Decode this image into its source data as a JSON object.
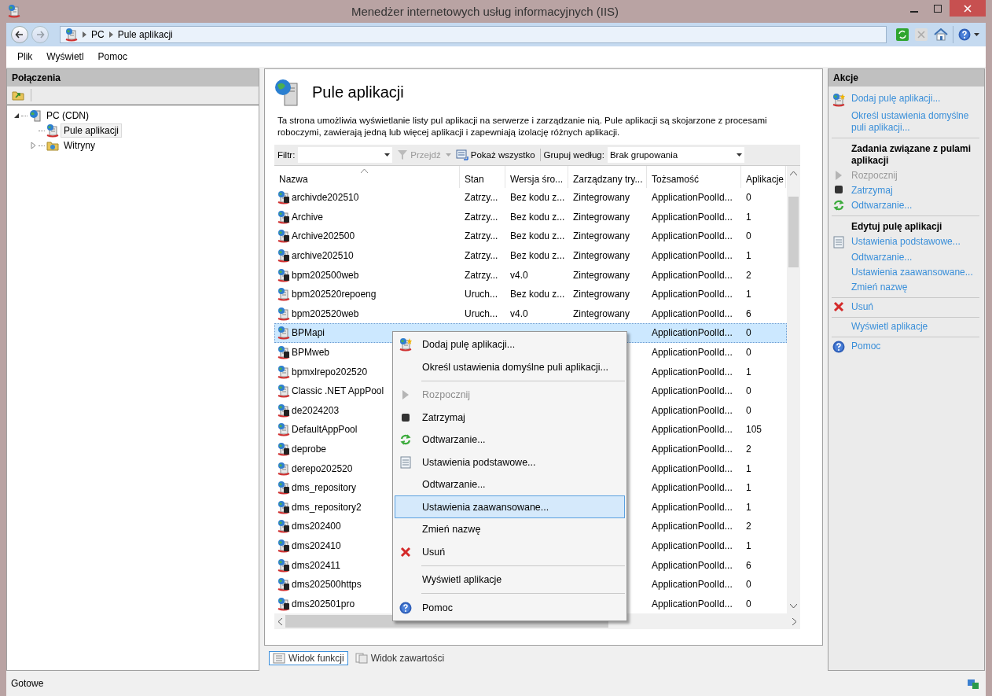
{
  "window": {
    "title": "Menedżer internetowych usług informacyjnych (IIS)"
  },
  "address": {
    "crumbs": [
      "PC",
      "Pule aplikacji"
    ]
  },
  "menu": [
    "Plik",
    "Wyświetl",
    "Pomoc"
  ],
  "connections": {
    "title": "Połączenia",
    "tree": [
      {
        "label": "PC (CDN)",
        "kind": "server",
        "expanded": true,
        "selected": false,
        "children": [
          {
            "label": "Pule aplikacji",
            "kind": "pool",
            "selected": true
          },
          {
            "label": "Witryny",
            "kind": "folder",
            "expanded": false,
            "selected": false
          }
        ]
      }
    ]
  },
  "page": {
    "title": "Pule aplikacji",
    "description": "Ta strona umożliwia wyświetlanie listy pul aplikacji na serwerze i zarządzanie nią. Pule aplikacji są skojarzone z procesami roboczymi, zawierają jedną lub więcej aplikacji i zapewniają izolację różnych aplikacji."
  },
  "filter_bar": {
    "filter_label": "Filtr:",
    "go": {
      "label": "Przejdź",
      "disabled": true
    },
    "show_all": "Pokaż wszystko",
    "group_label": "Grupuj według:",
    "group_value": "Brak grupowania"
  },
  "table": {
    "columns": [
      "Nazwa",
      "Stan",
      "Wersja śro...",
      "Zarządzany try...",
      "Tożsamość",
      "Aplikacje"
    ],
    "rows": [
      {
        "name": "archivde202510",
        "stopped": true,
        "selected": false,
        "state": "Zatrzy...",
        "version": "Bez kodu z...",
        "mode": "Zintegrowany",
        "identity": "ApplicationPoolId...",
        "apps": "0"
      },
      {
        "name": "Archive",
        "stopped": true,
        "selected": false,
        "state": "Zatrzy...",
        "version": "Bez kodu z...",
        "mode": "Zintegrowany",
        "identity": "ApplicationPoolId...",
        "apps": "1"
      },
      {
        "name": "Archive202500",
        "stopped": true,
        "selected": false,
        "state": "Zatrzy...",
        "version": "Bez kodu z...",
        "mode": "Zintegrowany",
        "identity": "ApplicationPoolId...",
        "apps": "0"
      },
      {
        "name": "archive202510",
        "stopped": true,
        "selected": false,
        "state": "Zatrzy...",
        "version": "Bez kodu z...",
        "mode": "Zintegrowany",
        "identity": "ApplicationPoolId...",
        "apps": "1"
      },
      {
        "name": "bpm202500web",
        "stopped": true,
        "selected": false,
        "state": "Zatrzy...",
        "version": "v4.0",
        "mode": "Zintegrowany",
        "identity": "ApplicationPoolId...",
        "apps": "2"
      },
      {
        "name": "bpm202520repoeng",
        "stopped": false,
        "selected": false,
        "state": "Uruch...",
        "version": "Bez kodu z...",
        "mode": "Zintegrowany",
        "identity": "ApplicationPoolId...",
        "apps": "1"
      },
      {
        "name": "bpm202520web",
        "stopped": false,
        "selected": false,
        "state": "Uruch...",
        "version": "v4.0",
        "mode": "Zintegrowany",
        "identity": "ApplicationPoolId...",
        "apps": "6"
      },
      {
        "name": "BPMapi",
        "stopped": false,
        "selected": true,
        "identity": "ApplicationPoolId...",
        "apps": "0"
      },
      {
        "name": "BPMweb",
        "stopped": true,
        "selected": false,
        "identity": "ApplicationPoolId...",
        "apps": "0"
      },
      {
        "name": "bpmxlrepo202520",
        "stopped": false,
        "selected": false,
        "identity": "ApplicationPoolId...",
        "apps": "1"
      },
      {
        "name": "Classic .NET AppPool",
        "stopped": false,
        "selected": false,
        "identity": "ApplicationPoolId...",
        "apps": "0"
      },
      {
        "name": "de2024203",
        "stopped": true,
        "selected": false,
        "identity": "ApplicationPoolId...",
        "apps": "0"
      },
      {
        "name": "DefaultAppPool",
        "stopped": false,
        "selected": false,
        "identity": "ApplicationPoolId...",
        "apps": "105"
      },
      {
        "name": "deprobe",
        "stopped": true,
        "selected": false,
        "identity": "ApplicationPoolId...",
        "apps": "2"
      },
      {
        "name": "derepo202520",
        "stopped": false,
        "selected": false,
        "identity": "ApplicationPoolId...",
        "apps": "1"
      },
      {
        "name": "dms_repository",
        "stopped": true,
        "selected": false,
        "identity": "ApplicationPoolId...",
        "apps": "1"
      },
      {
        "name": "dms_repository2",
        "stopped": true,
        "selected": false,
        "identity": "ApplicationPoolId...",
        "apps": "1"
      },
      {
        "name": "dms202400",
        "stopped": true,
        "selected": false,
        "identity": "ApplicationPoolId...",
        "apps": "2"
      },
      {
        "name": "dms202410",
        "stopped": true,
        "selected": false,
        "identity": "ApplicationPoolId...",
        "apps": "1"
      },
      {
        "name": "dms202411",
        "stopped": true,
        "selected": false,
        "identity": "ApplicationPoolId...",
        "apps": "6"
      },
      {
        "name": "dms202500https",
        "stopped": true,
        "selected": false,
        "identity": "ApplicationPoolId...",
        "apps": "0"
      },
      {
        "name": "dms202501pro",
        "stopped": true,
        "selected": false,
        "identity": "ApplicationPoolId...",
        "apps": "0"
      }
    ]
  },
  "context_menu": {
    "groups": [
      [
        {
          "label": "Dodaj pulę aplikacji...",
          "kind": "add",
          "disabled": false,
          "selected": false
        },
        {
          "label": "Określ ustawienia domyślne puli aplikacji...",
          "disabled": false,
          "selected": false
        }
      ],
      [
        {
          "label": "Rozpocznij",
          "kind": "start",
          "disabled": true,
          "selected": false
        },
        {
          "label": "Zatrzymaj",
          "kind": "stop",
          "disabled": false,
          "selected": false
        },
        {
          "label": "Odtwarzanie...",
          "kind": "recycle",
          "disabled": false,
          "selected": false
        },
        {
          "label": "Ustawienia podstawowe...",
          "kind": "settings",
          "disabled": false,
          "selected": false
        },
        {
          "label": "Odtwarzanie...",
          "disabled": false,
          "selected": false
        },
        {
          "label": "Ustawienia zaawansowane...",
          "disabled": false,
          "selected": true
        },
        {
          "label": "Zmień nazwę",
          "disabled": false,
          "selected": false
        },
        {
          "label": "Usuń",
          "kind": "delete",
          "disabled": false,
          "selected": false
        }
      ],
      [
        {
          "label": "Wyświetl aplikacje",
          "disabled": false,
          "selected": false
        }
      ],
      [
        {
          "label": "Pomoc",
          "kind": "help",
          "disabled": false,
          "selected": false
        }
      ]
    ]
  },
  "view_tabs": [
    {
      "label": "Widok funkcji",
      "selected": true
    },
    {
      "label": "Widok zawartości",
      "selected": false
    }
  ],
  "actions": {
    "title": "Akcje",
    "groups": [
      {
        "items": [
          {
            "label": "Dodaj pulę aplikacji...",
            "kind": "add",
            "disabled": false
          },
          {
            "label": "Określ ustawienia domyślne puli aplikacji...",
            "disabled": false
          }
        ]
      },
      {
        "heading": "Zadania związane z pulami aplikacji",
        "items": [
          {
            "label": "Rozpocznij",
            "kind": "start",
            "disabled": true
          },
          {
            "label": "Zatrzymaj",
            "kind": "stop",
            "disabled": false
          },
          {
            "label": "Odtwarzanie...",
            "kind": "recycle",
            "disabled": false
          }
        ]
      },
      {
        "heading": "Edytuj pulę aplikacji",
        "items": [
          {
            "label": "Ustawienia podstawowe...",
            "kind": "settings",
            "disabled": false
          },
          {
            "label": "Odtwarzanie...",
            "disabled": false
          },
          {
            "label": "Ustawienia zaawansowane...",
            "disabled": false
          },
          {
            "label": "Zmień nazwę",
            "disabled": false
          }
        ]
      },
      {
        "items": [
          {
            "label": "Usuń",
            "kind": "delete",
            "disabled": false
          }
        ]
      },
      {
        "items": [
          {
            "label": "Wyświetl aplikacje",
            "disabled": false
          }
        ]
      },
      {
        "items": [
          {
            "label": "Pomoc",
            "kind": "help",
            "disabled": false
          }
        ]
      }
    ]
  },
  "status_bar": {
    "text": "Gotowe"
  }
}
